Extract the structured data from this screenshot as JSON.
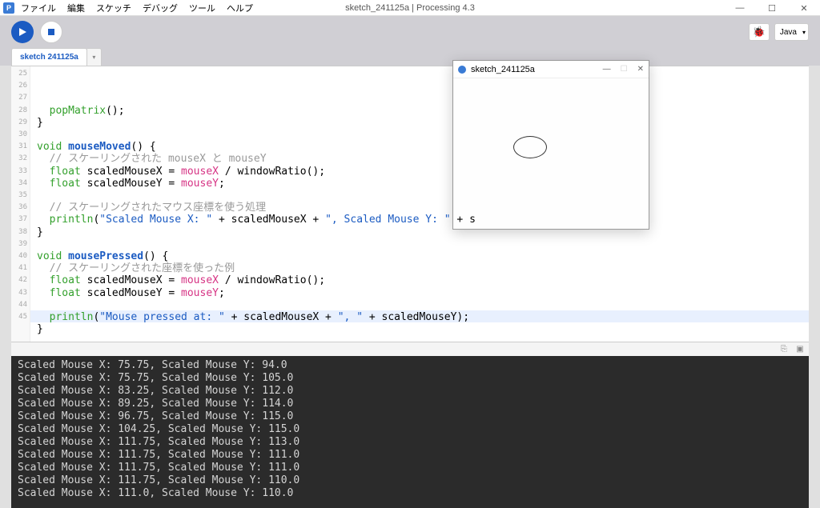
{
  "window": {
    "title": "sketch_241125a | Processing 4.3",
    "app_icon": "P"
  },
  "menu": {
    "file": "ファイル",
    "edit": "編集",
    "sketch": "スケッチ",
    "debug": "デバッグ",
    "tools": "ツール",
    "help": "ヘルプ"
  },
  "toolbar": {
    "mode": "Java"
  },
  "tabs": {
    "active": "sketch 241125a"
  },
  "gutter": {
    "start": 25,
    "end": 45
  },
  "code": {
    "lines": [
      {
        "t": "  popMatrix();",
        "seg": [
          {
            "c": "",
            "t": "  "
          },
          {
            "c": "kw-builtin",
            "t": "popMatrix"
          },
          {
            "c": "",
            "t": "();"
          }
        ]
      },
      {
        "t": "}",
        "seg": [
          {
            "c": "",
            "t": "}"
          }
        ]
      },
      {
        "t": "",
        "seg": []
      },
      {
        "t": "void mouseMoved() {",
        "seg": [
          {
            "c": "kw-type",
            "t": "void"
          },
          {
            "c": "",
            "t": " "
          },
          {
            "c": "kw-func",
            "t": "mouseMoved"
          },
          {
            "c": "",
            "t": "() {"
          }
        ]
      },
      {
        "t": "  // スケーリングされた mouseX と mouseY",
        "seg": [
          {
            "c": "",
            "t": "  "
          },
          {
            "c": "kw-cmt",
            "t": "// スケーリングされた mouseX と mouseY"
          }
        ]
      },
      {
        "t": "  float scaledMouseX = mouseX / windowRatio();",
        "seg": [
          {
            "c": "",
            "t": "  "
          },
          {
            "c": "kw-type",
            "t": "float"
          },
          {
            "c": "",
            "t": " scaledMouseX = "
          },
          {
            "c": "kw-var",
            "t": "mouseX"
          },
          {
            "c": "",
            "t": " / windowRatio();"
          }
        ]
      },
      {
        "t": "  float scaledMouseY = mouseY;",
        "seg": [
          {
            "c": "",
            "t": "  "
          },
          {
            "c": "kw-type",
            "t": "float"
          },
          {
            "c": "",
            "t": " scaledMouseY = "
          },
          {
            "c": "kw-var",
            "t": "mouseY"
          },
          {
            "c": "",
            "t": ";"
          }
        ]
      },
      {
        "t": "",
        "seg": []
      },
      {
        "t": "  // スケーリングされたマウス座標を使う処理",
        "seg": [
          {
            "c": "",
            "t": "  "
          },
          {
            "c": "kw-cmt",
            "t": "// スケーリングされたマウス座標を使う処理"
          }
        ]
      },
      {
        "t": "  println(\"Scaled Mouse X: \" + scaledMouseX + \", Scaled Mouse Y: \" + s",
        "seg": [
          {
            "c": "",
            "t": "  "
          },
          {
            "c": "kw-builtin",
            "t": "println"
          },
          {
            "c": "",
            "t": "("
          },
          {
            "c": "kw-str",
            "t": "\"Scaled Mouse X: \""
          },
          {
            "c": "",
            "t": " + scaledMouseX + "
          },
          {
            "c": "kw-str",
            "t": "\", Scaled Mouse Y: \""
          },
          {
            "c": "",
            "t": " + s"
          }
        ]
      },
      {
        "t": "}",
        "seg": [
          {
            "c": "",
            "t": "}"
          }
        ]
      },
      {
        "t": "",
        "seg": []
      },
      {
        "t": "void mousePressed() {",
        "seg": [
          {
            "c": "kw-type",
            "t": "void"
          },
          {
            "c": "",
            "t": " "
          },
          {
            "c": "kw-func",
            "t": "mousePressed"
          },
          {
            "c": "",
            "t": "() {"
          }
        ]
      },
      {
        "t": "  // スケーリングされた座標を使った例",
        "seg": [
          {
            "c": "",
            "t": "  "
          },
          {
            "c": "kw-cmt",
            "t": "// スケーリングされた座標を使った例"
          }
        ]
      },
      {
        "t": "  float scaledMouseX = mouseX / windowRatio();",
        "seg": [
          {
            "c": "",
            "t": "  "
          },
          {
            "c": "kw-type",
            "t": "float"
          },
          {
            "c": "",
            "t": " scaledMouseX = "
          },
          {
            "c": "kw-var",
            "t": "mouseX"
          },
          {
            "c": "",
            "t": " / windowRatio();"
          }
        ]
      },
      {
        "t": "  float scaledMouseY = mouseY;",
        "seg": [
          {
            "c": "",
            "t": "  "
          },
          {
            "c": "kw-type",
            "t": "float"
          },
          {
            "c": "",
            "t": " scaledMouseY = "
          },
          {
            "c": "kw-var",
            "t": "mouseY"
          },
          {
            "c": "",
            "t": ";"
          }
        ]
      },
      {
        "t": "",
        "seg": []
      },
      {
        "t": "  println(\"Mouse pressed at: \" + scaledMouseX + \", \" + scaledMouseY);",
        "seg": [
          {
            "c": "",
            "t": "  "
          },
          {
            "c": "kw-builtin",
            "t": "println"
          },
          {
            "c": "",
            "t": "("
          },
          {
            "c": "kw-str",
            "t": "\"Mouse pressed at: \""
          },
          {
            "c": "",
            "t": " + scaledMouseX + "
          },
          {
            "c": "kw-str",
            "t": "\", \""
          },
          {
            "c": "",
            "t": " + scaledMouseY);"
          }
        ]
      },
      {
        "t": "}",
        "seg": [
          {
            "c": "",
            "t": "}"
          }
        ]
      },
      {
        "t": "",
        "seg": []
      }
    ]
  },
  "console": {
    "lines": [
      "Scaled Mouse X: 75.75, Scaled Mouse Y: 94.0",
      "Scaled Mouse X: 75.75, Scaled Mouse Y: 105.0",
      "Scaled Mouse X: 83.25, Scaled Mouse Y: 112.0",
      "Scaled Mouse X: 89.25, Scaled Mouse Y: 114.0",
      "Scaled Mouse X: 96.75, Scaled Mouse Y: 115.0",
      "Scaled Mouse X: 104.25, Scaled Mouse Y: 115.0",
      "Scaled Mouse X: 111.75, Scaled Mouse Y: 113.0",
      "Scaled Mouse X: 111.75, Scaled Mouse Y: 111.0",
      "Scaled Mouse X: 111.75, Scaled Mouse Y: 111.0",
      "Scaled Mouse X: 111.75, Scaled Mouse Y: 110.0",
      "Scaled Mouse X: 111.0, Scaled Mouse Y: 110.0"
    ]
  },
  "sketch_window": {
    "title": "sketch_241125a"
  }
}
